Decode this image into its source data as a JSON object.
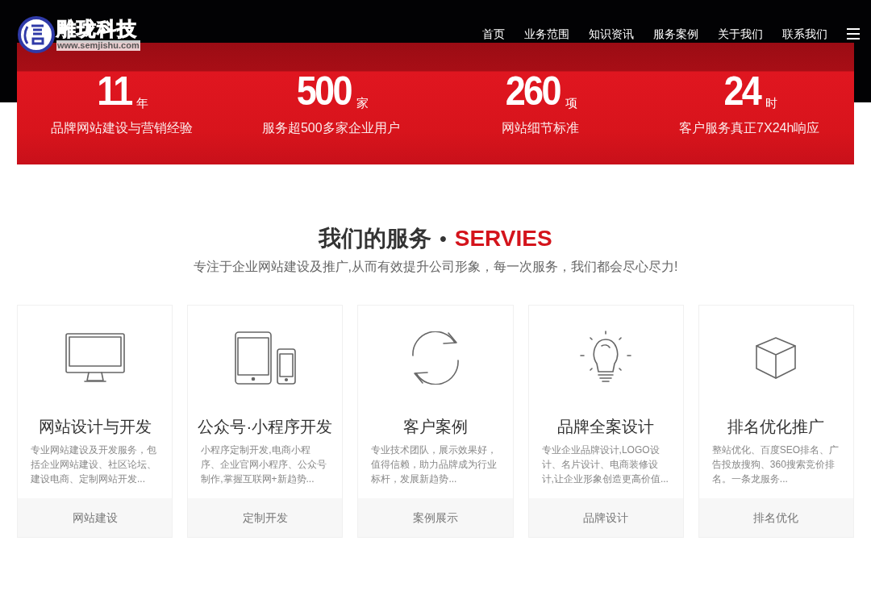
{
  "logo": {
    "name": "雕珑科技",
    "url": "www.semjishu.com"
  },
  "nav": [
    "首页",
    "业务范围",
    "知识资讯",
    "服务案例",
    "关于我们",
    "联系我们"
  ],
  "stats": [
    {
      "number": "11",
      "unit": "年",
      "label": "品牌网站建设与营销经验"
    },
    {
      "number": "500",
      "unit": "家",
      "label": "服务超500多家企业用户"
    },
    {
      "number": "260",
      "unit": "项",
      "label": "网站细节标准"
    },
    {
      "number": "24",
      "unit": "时",
      "label": "客户服务真正7X24h响应"
    }
  ],
  "services": {
    "title": "我们的服务",
    "separator": "•",
    "title_en": "SERVIES",
    "subtitle": "专注于企业网站建设及推广,从而有效提升公司形象，每一次服务，我们都会尽心尽力!",
    "cards": [
      {
        "kind": "monitor",
        "title": "网站设计与开发",
        "description": "专业网站建设及开发服务，包括企业网站建设、社区论坛、建设电商、定制网站开发...",
        "footer": "网站建设"
      },
      {
        "kind": "devices",
        "title": "公众号·小程序开发",
        "description": "小程序定制开发,电商小程序、企业官网小程序、公众号制作,掌握互联网+新趋势...",
        "footer": "定制开发"
      },
      {
        "kind": "refresh",
        "title": "客户案例",
        "description": "专业技术团队，展示效果好，值得信赖，助力品牌成为行业标杆，发展新趋势...",
        "footer": "案例展示"
      },
      {
        "kind": "bulb",
        "title": "品牌全案设计",
        "description": "专业企业品牌设计,LOGO设计、名片设计、电商装修设计,让企业形象创造更高价值...",
        "footer": "品牌设计"
      },
      {
        "kind": "cube",
        "title": "排名优化推广",
        "description": "整站优化、百度SEO排名、广告投放搜狗、360搜索竞价排名。一条龙服务...",
        "footer": "排名优化"
      }
    ]
  }
}
